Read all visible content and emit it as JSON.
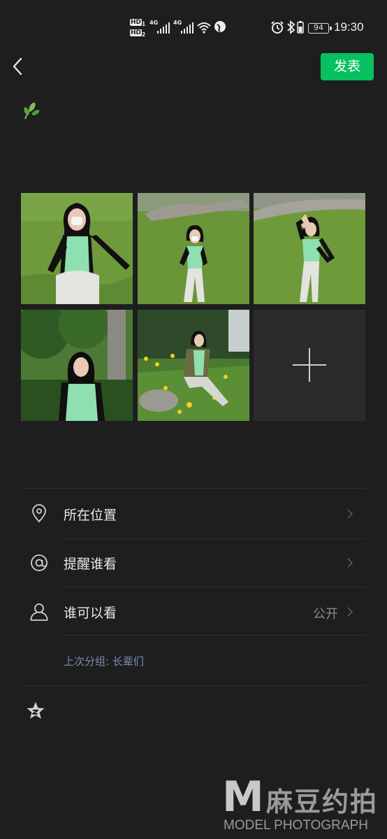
{
  "status_bar": {
    "hd1": "HD",
    "hd1_sub": "1",
    "hd2": "HD",
    "hd2_sub": "2",
    "net1": "4G",
    "net2": "4G",
    "battery": "94",
    "time": "19:30"
  },
  "header": {
    "publish_label": "发表"
  },
  "photos": [
    {
      "name": "photo-1",
      "scene": "grass-sitting-close"
    },
    {
      "name": "photo-2",
      "scene": "grass-sitting-far"
    },
    {
      "name": "photo-3",
      "scene": "grass-waving"
    },
    {
      "name": "photo-4",
      "scene": "trees-portrait"
    },
    {
      "name": "photo-5",
      "scene": "flowers-sitting"
    }
  ],
  "options": {
    "location_label": "所在位置",
    "mention_label": "提醒谁看",
    "visibility_label": "谁可以看",
    "visibility_value": "公开",
    "last_group_text": "上次分组: 长辈们"
  },
  "watermark": {
    "letter": "M",
    "chinese": "麻豆约拍",
    "english": "MODEL PHOTOGRAPH"
  },
  "colors": {
    "background": "#1e1e1e",
    "accent": "#07c160",
    "link_blue": "#7c8eb3"
  }
}
